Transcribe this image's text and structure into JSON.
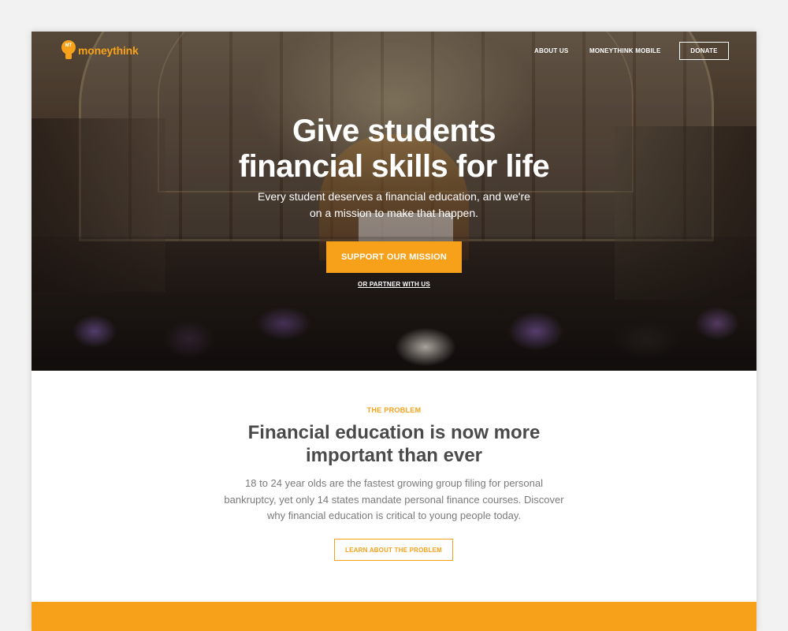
{
  "brand": {
    "logo_icon_text": "MT",
    "logo_text": "moneythink",
    "accent_color": "#f7a11a"
  },
  "nav": {
    "about": "ABOUT US",
    "mobile": "MONEYTHINK MOBILE",
    "donate": "DONATE"
  },
  "hero": {
    "title_line1": "Give students",
    "title_line2": "financial skills for life",
    "subtitle_line1": "Every student deserves a financial education, and we're",
    "subtitle_line2": "on a mission to make that happen.",
    "cta": "SUPPORT OUR MISSION",
    "partner_link": "OR PARTNER WITH US"
  },
  "problem": {
    "eyebrow": "THE PROBLEM",
    "title_line1": "Financial education is now more",
    "title_line2": "important than ever",
    "body_line1": "18 to 24 year olds are the fastest growing group filing for personal",
    "body_line2": "bankruptcy, yet only 14 states mandate personal finance courses. Discover",
    "body_line3": "why financial education is critical to young people today.",
    "button": "LEARN ABOUT THE PROBLEM"
  }
}
